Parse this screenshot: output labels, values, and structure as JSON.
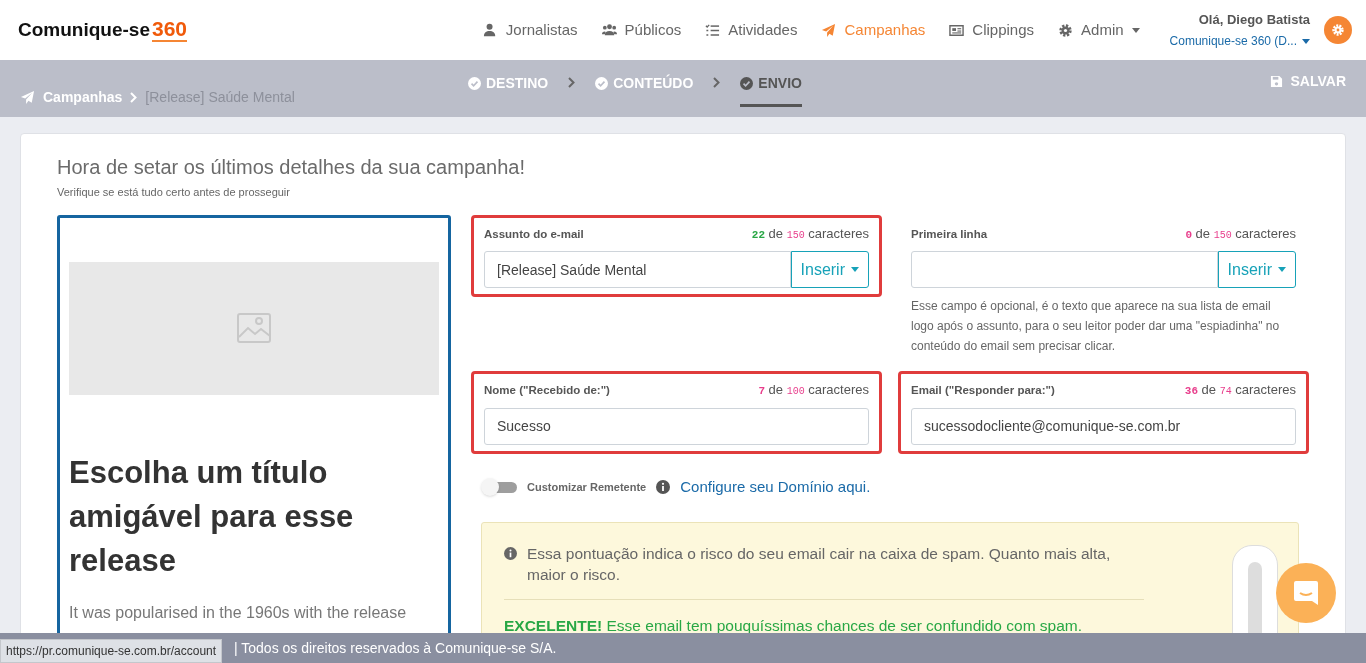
{
  "brand": {
    "name": "Comunique-se",
    "suffix": "360"
  },
  "nav": [
    {
      "label": "Jornalistas",
      "selected": false
    },
    {
      "label": "Públicos",
      "selected": false
    },
    {
      "label": "Atividades",
      "selected": false
    },
    {
      "label": "Campanhas",
      "selected": true
    },
    {
      "label": "Clippings",
      "selected": false
    },
    {
      "label": "Admin",
      "selected": false,
      "dropdown": true
    }
  ],
  "user": {
    "greeting": "Olá, Diego Batista",
    "account": "Comunique-se 360 (D..."
  },
  "breadcrumb": [
    "Campanhas",
    "[Release] Saúde Mental"
  ],
  "steps": [
    {
      "label": "DESTINO",
      "selected": false
    },
    {
      "label": "CONTEÚDO",
      "selected": false
    },
    {
      "label": "ENVIO",
      "selected": true
    }
  ],
  "save_label": "SALVAR",
  "page": {
    "title": "Hora de setar os últimos detalhes da sua campanha!",
    "subtitle": "Verifique se está tudo certo antes de prosseguir"
  },
  "preview": {
    "heading": "Escolha um título amigável para esse release",
    "body": "It was popularised in the 1960s with the release"
  },
  "fields": [
    {
      "label": "Assunto do e-mail",
      "count": "22",
      "of": "de",
      "max": "150",
      "unit": "caracteres",
      "color": "#28a745",
      "value": "[Release] Saúde Mental",
      "insert": "Inserir",
      "highlighted": true
    },
    {
      "label": "Primeira linha",
      "count": "0",
      "of": "de",
      "max": "150",
      "unit": "caracteres",
      "color": "#e83e8c",
      "insert": "Inserir",
      "highlighted": false,
      "help": "Esse campo é opcional, é o texto que aparece na sua lista de email logo após o assunto, para o seu leitor poder dar uma \"espiadinha\" no conteúdo do email sem precisar clicar."
    },
    {
      "label": "Nome (\"Recebido de:\")",
      "count": "7",
      "of": "de",
      "max": "100",
      "unit": "caracteres",
      "color": "#e83e8c",
      "value": "Sucesso",
      "highlighted": true
    },
    {
      "label": "Email (\"Responder para:\")",
      "count": "36",
      "of": "de",
      "max": "74",
      "unit": "caracteres",
      "color": "#e83e8c",
      "value": "sucessodocliente@comunique-se.com.br",
      "highlighted": true
    }
  ],
  "sender_toggle": {
    "label": "Customizar Remetente",
    "on": false
  },
  "domain_link": "Configure seu Domínio aqui.",
  "spam": {
    "info": "Essa pontuação indica o risco do seu email cair na caixa de spam. Quanto mais alta, maior o risco.",
    "verdict": "**EXCELENTE!** Esse email tem pouquíssimas chances de ser confundido com spam."
  },
  "footer": "| Todos os direitos reservados à Comunique-se S/A.",
  "status_url": "https://pr.comunique-se.com.br/account"
}
